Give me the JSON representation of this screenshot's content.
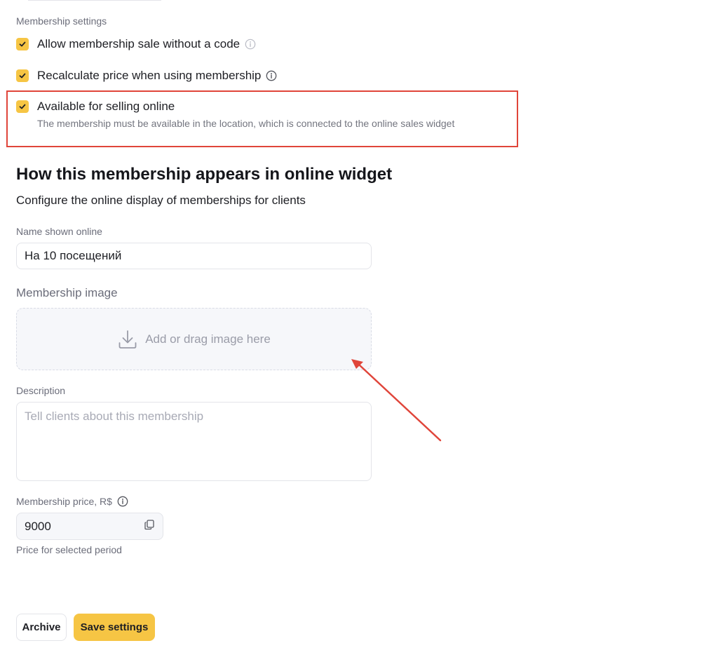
{
  "membership_settings": {
    "section_label": "Membership settings",
    "options": [
      {
        "label": "Allow membership sale without a code",
        "checked": true
      },
      {
        "label": "Recalculate price when using membership",
        "checked": true
      },
      {
        "label": "Available for selling online",
        "checked": true,
        "description": "The membership must be available in the location, which is connected to the online sales widget"
      }
    ]
  },
  "online_widget": {
    "title": "How this membership appears in online widget",
    "subtitle": "Configure the online display of memberships for clients",
    "name_label": "Name shown online",
    "name_value": "На 10 посещений",
    "image_label": "Membership image",
    "image_placeholder": "Add or drag image here",
    "description_label": "Description",
    "description_placeholder": "Tell clients about this membership",
    "price_label": "Membership price, R$",
    "price_value": "9000",
    "price_hint": "Price for selected period"
  },
  "actions": {
    "archive_label": "Archive",
    "save_label": "Save settings"
  },
  "colors": {
    "accent": "#f6c544",
    "annotation": "#e0453a"
  }
}
